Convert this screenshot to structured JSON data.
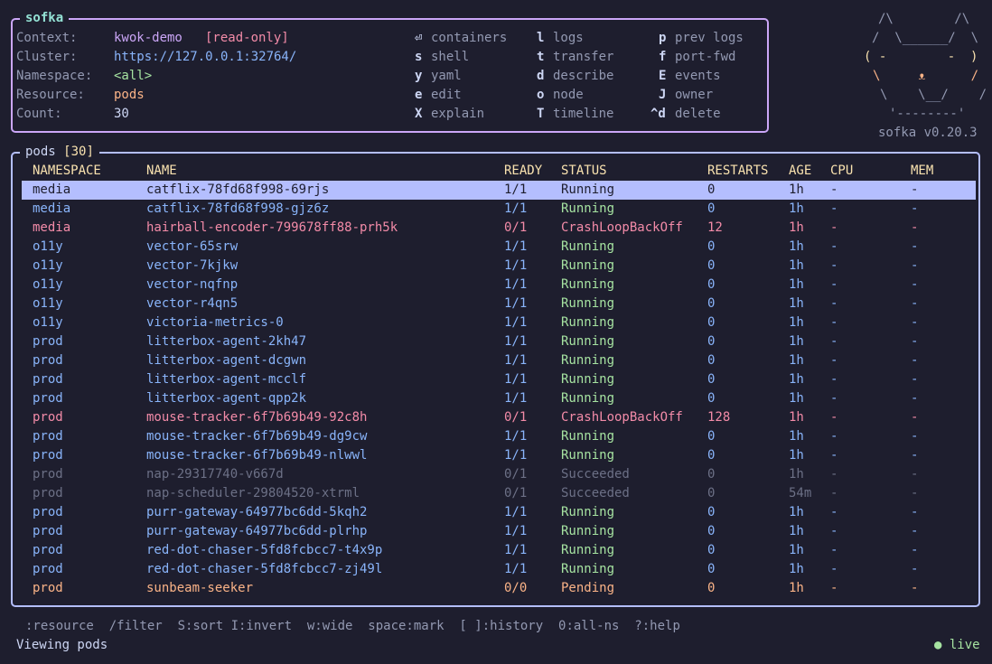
{
  "app": {
    "title": "sofka",
    "version": "sofka v0.20.3",
    "logo_lines": [
      "/\\        /\\",
      "/  \\______/  \\",
      "( -        -  )",
      "\\     ᴥ      /",
      "\\    \\__/    /",
      "'--------'"
    ]
  },
  "context": [
    {
      "label": "Context:",
      "value": "kwok-demo",
      "extra": "[read-only]"
    },
    {
      "label": "Cluster:",
      "value": "https://127.0.0.1:32764/"
    },
    {
      "label": "Namespace:",
      "value": "<all>"
    },
    {
      "label": "Resource:",
      "value": "pods"
    },
    {
      "label": "Count:",
      "value": "30"
    }
  ],
  "shortcuts": [
    [
      {
        "key": "⏎",
        "action": "containers"
      },
      {
        "key": "l",
        "action": "logs"
      },
      {
        "key": "p",
        "action": "prev logs"
      }
    ],
    [
      {
        "key": "s",
        "action": "shell"
      },
      {
        "key": "t",
        "action": "transfer"
      },
      {
        "key": "f",
        "action": "port-fwd"
      }
    ],
    [
      {
        "key": "y",
        "action": "yaml"
      },
      {
        "key": "d",
        "action": "describe"
      },
      {
        "key": "E",
        "action": "events"
      }
    ],
    [
      {
        "key": "e",
        "action": "edit"
      },
      {
        "key": "o",
        "action": "node"
      },
      {
        "key": "J",
        "action": "owner"
      }
    ],
    [
      {
        "key": "X",
        "action": "explain"
      },
      {
        "key": "T",
        "action": "timeline"
      },
      {
        "key": "^d",
        "action": "delete"
      }
    ]
  ],
  "table": {
    "title": "pods",
    "count": "[30]",
    "columns": [
      "NAMESPACE",
      "NAME",
      "READY",
      "STATUS",
      "RESTARTS",
      "AGE",
      "CPU",
      "MEM"
    ],
    "rows": [
      {
        "ns": "media",
        "name": "catflix-78fd68f998-69rjs",
        "ready": "1/1",
        "status": "Running",
        "restarts": "0",
        "age": "1h",
        "cpu": "-",
        "mem": "-",
        "state": "sel"
      },
      {
        "ns": "media",
        "name": "catflix-78fd68f998-gjz6z",
        "ready": "1/1",
        "status": "Running",
        "restarts": "0",
        "age": "1h",
        "cpu": "-",
        "mem": "-",
        "state": "run"
      },
      {
        "ns": "media",
        "name": "hairball-encoder-799678ff88-prh5k",
        "ready": "0/1",
        "status": "CrashLoopBackOff",
        "restarts": "12",
        "age": "1h",
        "cpu": "-",
        "mem": "-",
        "state": "err"
      },
      {
        "ns": "o11y",
        "name": "vector-65srw",
        "ready": "1/1",
        "status": "Running",
        "restarts": "0",
        "age": "1h",
        "cpu": "-",
        "mem": "-",
        "state": "run"
      },
      {
        "ns": "o11y",
        "name": "vector-7kjkw",
        "ready": "1/1",
        "status": "Running",
        "restarts": "0",
        "age": "1h",
        "cpu": "-",
        "mem": "-",
        "state": "run"
      },
      {
        "ns": "o11y",
        "name": "vector-nqfnp",
        "ready": "1/1",
        "status": "Running",
        "restarts": "0",
        "age": "1h",
        "cpu": "-",
        "mem": "-",
        "state": "run"
      },
      {
        "ns": "o11y",
        "name": "vector-r4qn5",
        "ready": "1/1",
        "status": "Running",
        "restarts": "0",
        "age": "1h",
        "cpu": "-",
        "mem": "-",
        "state": "run"
      },
      {
        "ns": "o11y",
        "name": "victoria-metrics-0",
        "ready": "1/1",
        "status": "Running",
        "restarts": "0",
        "age": "1h",
        "cpu": "-",
        "mem": "-",
        "state": "run"
      },
      {
        "ns": "prod",
        "name": "litterbox-agent-2kh47",
        "ready": "1/1",
        "status": "Running",
        "restarts": "0",
        "age": "1h",
        "cpu": "-",
        "mem": "-",
        "state": "run"
      },
      {
        "ns": "prod",
        "name": "litterbox-agent-dcgwn",
        "ready": "1/1",
        "status": "Running",
        "restarts": "0",
        "age": "1h",
        "cpu": "-",
        "mem": "-",
        "state": "run"
      },
      {
        "ns": "prod",
        "name": "litterbox-agent-mcclf",
        "ready": "1/1",
        "status": "Running",
        "restarts": "0",
        "age": "1h",
        "cpu": "-",
        "mem": "-",
        "state": "run"
      },
      {
        "ns": "prod",
        "name": "litterbox-agent-qpp2k",
        "ready": "1/1",
        "status": "Running",
        "restarts": "0",
        "age": "1h",
        "cpu": "-",
        "mem": "-",
        "state": "run"
      },
      {
        "ns": "prod",
        "name": "mouse-tracker-6f7b69b49-92c8h",
        "ready": "0/1",
        "status": "CrashLoopBackOff",
        "restarts": "128",
        "age": "1h",
        "cpu": "-",
        "mem": "-",
        "state": "err"
      },
      {
        "ns": "prod",
        "name": "mouse-tracker-6f7b69b49-dg9cw",
        "ready": "1/1",
        "status": "Running",
        "restarts": "0",
        "age": "1h",
        "cpu": "-",
        "mem": "-",
        "state": "run"
      },
      {
        "ns": "prod",
        "name": "mouse-tracker-6f7b69b49-nlwwl",
        "ready": "1/1",
        "status": "Running",
        "restarts": "0",
        "age": "1h",
        "cpu": "-",
        "mem": "-",
        "state": "run"
      },
      {
        "ns": "prod",
        "name": "nap-29317740-v667d",
        "ready": "0/1",
        "status": "Succeeded",
        "restarts": "0",
        "age": "1h",
        "cpu": "-",
        "mem": "-",
        "state": "done"
      },
      {
        "ns": "prod",
        "name": "nap-scheduler-29804520-xtrml",
        "ready": "0/1",
        "status": "Succeeded",
        "restarts": "0",
        "age": "54m",
        "cpu": "-",
        "mem": "-",
        "state": "done"
      },
      {
        "ns": "prod",
        "name": "purr-gateway-64977bc6dd-5kqh2",
        "ready": "1/1",
        "status": "Running",
        "restarts": "0",
        "age": "1h",
        "cpu": "-",
        "mem": "-",
        "state": "run"
      },
      {
        "ns": "prod",
        "name": "purr-gateway-64977bc6dd-plrhp",
        "ready": "1/1",
        "status": "Running",
        "restarts": "0",
        "age": "1h",
        "cpu": "-",
        "mem": "-",
        "state": "run"
      },
      {
        "ns": "prod",
        "name": "red-dot-chaser-5fd8fcbcc7-t4x9p",
        "ready": "1/1",
        "status": "Running",
        "restarts": "0",
        "age": "1h",
        "cpu": "-",
        "mem": "-",
        "state": "run"
      },
      {
        "ns": "prod",
        "name": "red-dot-chaser-5fd8fcbcc7-zj49l",
        "ready": "1/1",
        "status": "Running",
        "restarts": "0",
        "age": "1h",
        "cpu": "-",
        "mem": "-",
        "state": "run"
      },
      {
        "ns": "prod",
        "name": "sunbeam-seeker",
        "ready": "0/0",
        "status": "Pending",
        "restarts": "0",
        "age": "1h",
        "cpu": "-",
        "mem": "-",
        "state": "pend"
      }
    ]
  },
  "footer": {
    "hints": ":resource  /filter  S:sort I:invert  w:wide  space:mark  [ ]:history  0:all-ns  ?:help",
    "status": "Viewing pods",
    "live_dot": "●",
    "live": "live"
  },
  "colors": {
    "accent_border_top": "#cba6f7",
    "accent_border_table": "#b4befe",
    "title": "#94e2d5",
    "running": "#a6e3a1",
    "error": "#f38ba8",
    "pending": "#fab387",
    "muted": "#6c7086"
  }
}
